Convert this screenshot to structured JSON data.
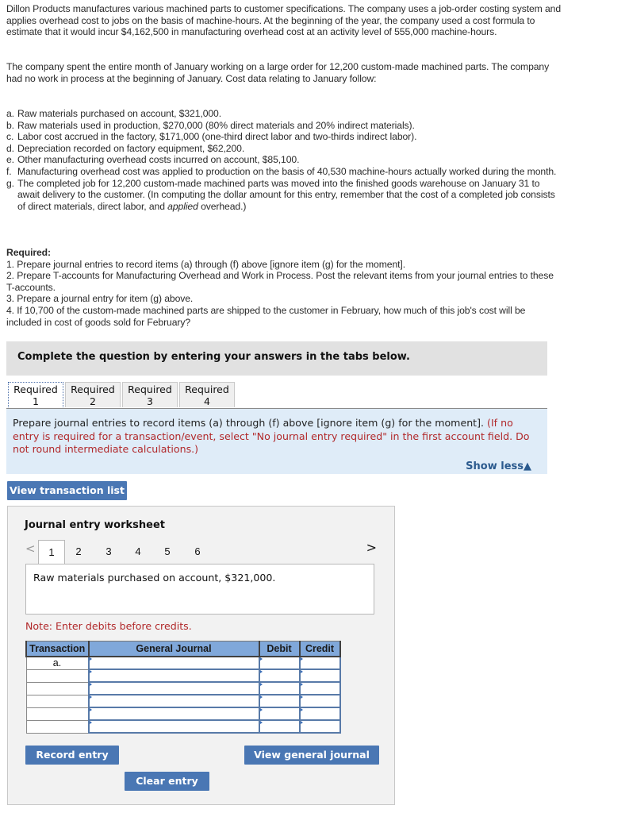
{
  "problem": {
    "intro": "Dillon Products manufactures various machined parts to customer specifications. The company uses a job-order costing system and applies overhead cost to jobs on the basis of machine-hours. At the beginning of the year, the company used a cost formula to estimate that it would incur $4,162,500 in manufacturing overhead cost at an activity level of 555,000 machine-hours.",
    "context": "The company spent the entire month of January working on a large order for 12,200 custom-made machined parts. The company had no work in process at the beginning of January. Cost data relating to January follow:",
    "items": [
      {
        "label": "a.",
        "text": "Raw materials purchased on account, $321,000."
      },
      {
        "label": "b.",
        "text": "Raw materials used in production, $270,000 (80% direct materials and 20% indirect materials)."
      },
      {
        "label": "c.",
        "text": "Labor cost accrued in the factory, $171,000 (one-third direct labor and two-thirds indirect labor)."
      },
      {
        "label": "d.",
        "text": "Depreciation recorded on factory equipment, $62,200."
      },
      {
        "label": "e.",
        "text": "Other manufacturing overhead costs incurred on account, $85,100."
      },
      {
        "label": "f.",
        "text": "Manufacturing overhead cost was applied to production on the basis of 40,530 machine-hours actually worked during the month."
      },
      {
        "label": "g.",
        "text_before": "The completed job for 12,200 custom-made machined parts was moved into the finished goods warehouse on January 31 to await delivery to the customer. (In computing the dollar amount for this entry, remember that the cost of a completed job consists of direct materials, direct labor, and ",
        "text_italic": "applied",
        "text_after": " overhead.)"
      }
    ],
    "required_heading": "Required:",
    "required": [
      "1. Prepare journal entries to record items (a) through (f) above [ignore item (g) for the moment].",
      "2. Prepare T-accounts for Manufacturing Overhead and Work in Process. Post the relevant items from your journal entries to these T-accounts.",
      "3. Prepare a journal entry for item (g) above.",
      "4. If 10,700 of the custom-made machined parts are shipped to the customer in February, how much of this job's cost will be included in cost of goods sold for February?"
    ]
  },
  "banner": "Complete the question by entering your answers in the tabs below.",
  "tabs": [
    {
      "line1": "Required",
      "line2": "1",
      "active": true
    },
    {
      "line1": "Required",
      "line2": "2",
      "active": false
    },
    {
      "line1": "Required",
      "line2": "3",
      "active": false
    },
    {
      "line1": "Required",
      "line2": "4",
      "active": false
    }
  ],
  "instructions": {
    "main": "Prepare journal entries to record items (a) through (f) above [ignore item (g) for the moment]. ",
    "red": "(If no entry is required for a transaction/event, select \"No journal entry required\" in the first account field. Do not round intermediate calculations.)",
    "show_less": "Show less",
    "show_less_icon": "▲"
  },
  "view_transaction_list": "View transaction list",
  "worksheet": {
    "title": "Journal entry worksheet",
    "prev_icon": "<",
    "next_icon": ">",
    "pages": [
      "1",
      "2",
      "3",
      "4",
      "5",
      "6"
    ],
    "active_page": "1",
    "description": "Raw materials purchased on account, $321,000.",
    "note": "Note: Enter debits before credits.",
    "table": {
      "headers": [
        "Transaction",
        "General Journal",
        "Debit",
        "Credit"
      ],
      "rows": [
        {
          "transaction": "a.",
          "account": "",
          "debit": "",
          "credit": ""
        },
        {
          "transaction": "",
          "account": "",
          "debit": "",
          "credit": ""
        },
        {
          "transaction": "",
          "account": "",
          "debit": "",
          "credit": ""
        },
        {
          "transaction": "",
          "account": "",
          "debit": "",
          "credit": ""
        },
        {
          "transaction": "",
          "account": "",
          "debit": "",
          "credit": ""
        },
        {
          "transaction": "",
          "account": "",
          "debit": "",
          "credit": ""
        }
      ]
    },
    "buttons": {
      "record": "Record entry",
      "clear": "Clear entry",
      "view_journal": "View general journal"
    }
  }
}
